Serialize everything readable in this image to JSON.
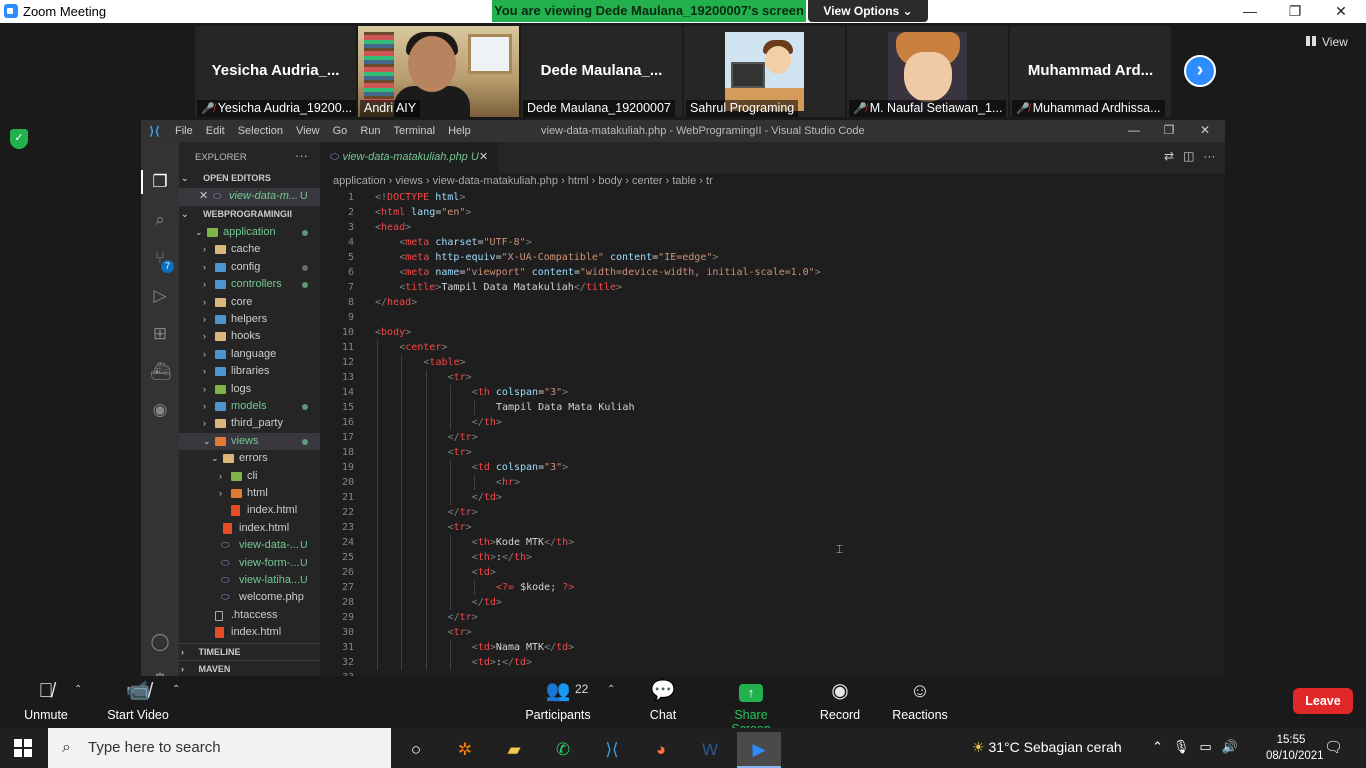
{
  "zoom": {
    "window_title": "Zoom Meeting",
    "share_banner": "You are viewing Dede Maulana_19200007's screen",
    "view_options": "View Options ⌄",
    "view_label": "View",
    "participants": [
      {
        "big_name": "Yesicha  Audria_...",
        "caption": "Yesicha Audria_19200...",
        "muted": true
      },
      {
        "big_name": "",
        "caption": "Andri AIY",
        "muted": false
      },
      {
        "big_name": "Dede  Maulana_...",
        "caption": "Dede Maulana_19200007",
        "muted": false
      },
      {
        "big_name": "",
        "caption": "Sahrul Programing",
        "muted": false
      },
      {
        "big_name": "",
        "caption": "M. Naufal Setiawan_1...",
        "muted": true
      },
      {
        "big_name": "Muhammad  Ard...",
        "caption": "Muhammad Ardhissa...",
        "muted": true
      }
    ],
    "toolbar": {
      "unmute": "Unmute",
      "start_video": "Start Video",
      "participants": "Participants",
      "participants_count": "22",
      "chat": "Chat",
      "share_screen": "Share Screen",
      "record": "Record",
      "reactions": "Reactions",
      "leave": "Leave"
    }
  },
  "vscode": {
    "menu": [
      "File",
      "Edit",
      "Selection",
      "View",
      "Go",
      "Run",
      "Terminal",
      "Help"
    ],
    "window_title": "view-data-matakuliah.php - WebProgramingII - Visual Studio Code",
    "explorer_title": "EXPLORER",
    "open_editors_label": "OPEN EDITORS",
    "open_editor_file": "view-data-m...",
    "open_editor_status": "U",
    "workspace_label": "WEBPROGRAMINGII",
    "timeline_label": "TIMELINE",
    "maven_label": "MAVEN",
    "scm_badge": "7",
    "tree": [
      {
        "label": "application",
        "depth": 1,
        "open": true,
        "kind": "folder-green",
        "status": "dot"
      },
      {
        "label": "cache",
        "depth": 2,
        "open": false,
        "kind": "folder"
      },
      {
        "label": "config",
        "depth": 2,
        "open": false,
        "kind": "folder-blue",
        "status": "dot-grey"
      },
      {
        "label": "controllers",
        "depth": 2,
        "open": false,
        "kind": "folder-blue",
        "status": "dot"
      },
      {
        "label": "core",
        "depth": 2,
        "open": false,
        "kind": "folder"
      },
      {
        "label": "helpers",
        "depth": 2,
        "open": false,
        "kind": "folder-blue"
      },
      {
        "label": "hooks",
        "depth": 2,
        "open": false,
        "kind": "folder"
      },
      {
        "label": "language",
        "depth": 2,
        "open": false,
        "kind": "folder-blue"
      },
      {
        "label": "libraries",
        "depth": 2,
        "open": false,
        "kind": "folder-blue"
      },
      {
        "label": "logs",
        "depth": 2,
        "open": false,
        "kind": "folder-green"
      },
      {
        "label": "models",
        "depth": 2,
        "open": false,
        "kind": "folder-blue",
        "status": "dot"
      },
      {
        "label": "third_party",
        "depth": 2,
        "open": false,
        "kind": "folder"
      },
      {
        "label": "views",
        "depth": 2,
        "open": true,
        "kind": "folder-red",
        "status": "dot",
        "selected": true
      },
      {
        "label": "errors",
        "depth": 3,
        "open": true,
        "kind": "folder"
      },
      {
        "label": "cli",
        "depth": 4,
        "open": false,
        "kind": "folder-green"
      },
      {
        "label": "html",
        "depth": 4,
        "open": false,
        "kind": "folder-red"
      },
      {
        "label": "index.html",
        "depth": 4,
        "kind": "html"
      },
      {
        "label": "index.html",
        "depth": 3,
        "kind": "html"
      },
      {
        "label": "view-data-...",
        "depth": 3,
        "kind": "php",
        "status": "U"
      },
      {
        "label": "view-form-...",
        "depth": 3,
        "kind": "php",
        "status": "U"
      },
      {
        "label": "view-latiha...",
        "depth": 3,
        "kind": "php",
        "status": "U"
      },
      {
        "label": "welcome.php",
        "depth": 3,
        "kind": "php"
      },
      {
        "label": ".htaccess",
        "depth": 2,
        "kind": "file"
      },
      {
        "label": "index.html",
        "depth": 2,
        "kind": "html"
      }
    ],
    "tab_label": "view-data-matakuliah.php",
    "tab_status": "U",
    "breadcrumb": [
      "application",
      "views",
      "view-data-matakuliah.php",
      "html",
      "body",
      "center",
      "table",
      "tr"
    ],
    "code_lines": [
      {
        "n": "1",
        "indent": 0,
        "html": "<span class='br'>&lt;!</span><span class='tagr'>DOCTYPE</span> <span class='attr'>html</span><span class='br'>&gt;</span>"
      },
      {
        "n": "2",
        "indent": 0,
        "html": "<span class='br'>&lt;</span><span class='tagr'>html</span> <span class='attr'>lang</span>=<span class='str'>\"en\"</span><span class='br'>&gt;</span>"
      },
      {
        "n": "3",
        "indent": 0,
        "html": "<span class='br'>&lt;</span><span class='tagr'>head</span><span class='br'>&gt;</span>"
      },
      {
        "n": "4",
        "indent": 1,
        "html": "<span class='br'>&lt;</span><span class='tagr'>meta</span> <span class='attr'>charset</span>=<span class='str'>\"UTF-8\"</span><span class='br'>&gt;</span>"
      },
      {
        "n": "5",
        "indent": 1,
        "html": "<span class='br'>&lt;</span><span class='tagr'>meta</span> <span class='attr'>http-equiv</span>=<span class='str'>\"X-UA-Compatible\"</span> <span class='attr'>content</span>=<span class='str'>\"IE=edge\"</span><span class='br'>&gt;</span>"
      },
      {
        "n": "6",
        "indent": 1,
        "html": "<span class='br'>&lt;</span><span class='tagr'>meta</span> <span class='attr'>name</span>=<span class='str'>\"viewport\"</span> <span class='attr'>content</span>=<span class='str'>\"width=device-width, initial-scale=1.0\"</span><span class='br'>&gt;</span>"
      },
      {
        "n": "7",
        "indent": 1,
        "html": "<span class='br'>&lt;</span><span class='tagr'>title</span><span class='br'>&gt;</span>Tampil Data Matakuliah<span class='br'>&lt;/</span><span class='tagr'>title</span><span class='br'>&gt;</span>"
      },
      {
        "n": "8",
        "indent": 0,
        "html": "<span class='br'>&lt;/</span><span class='tagr'>head</span><span class='br'>&gt;</span>"
      },
      {
        "n": "9",
        "indent": 0,
        "html": ""
      },
      {
        "n": "10",
        "indent": 0,
        "html": "<span class='br'>&lt;</span><span class='tagr'>body</span><span class='br'>&gt;</span>"
      },
      {
        "n": "11",
        "indent": 1,
        "html": "<span class='br'>&lt;</span><span class='tagr'>center</span><span class='br'>&gt;</span>"
      },
      {
        "n": "12",
        "indent": 2,
        "html": "<span class='br'>&lt;</span><span class='tagr'>table</span><span class='br'>&gt;</span>"
      },
      {
        "n": "13",
        "indent": 3,
        "html": "<span class='br'>&lt;</span><span class='tagr'>tr</span><span class='br'>&gt;</span>"
      },
      {
        "n": "14",
        "indent": 4,
        "html": "<span class='br'>&lt;</span><span class='tagr'>th</span> <span class='attr'>colspan</span>=<span class='str'>\"3\"</span><span class='br'>&gt;</span>"
      },
      {
        "n": "15",
        "indent": 5,
        "html": "Tampil Data Mata Kuliah"
      },
      {
        "n": "16",
        "indent": 4,
        "html": "<span class='br'>&lt;/</span><span class='tagr'>th</span><span class='br'>&gt;</span>"
      },
      {
        "n": "17",
        "indent": 3,
        "html": "<span class='br'>&lt;/</span><span class='tagr'>tr</span><span class='br'>&gt;</span>"
      },
      {
        "n": "18",
        "indent": 3,
        "html": "<span class='br'>&lt;</span><span class='tagr'>tr</span><span class='br'>&gt;</span>"
      },
      {
        "n": "19",
        "indent": 4,
        "html": "<span class='br'>&lt;</span><span class='tagr'>td</span> <span class='attr'>colspan</span>=<span class='str'>\"3\"</span><span class='br'>&gt;</span>"
      },
      {
        "n": "20",
        "indent": 5,
        "html": "<span class='br'>&lt;</span><span class='tagr'>hr</span><span class='br'>&gt;</span>"
      },
      {
        "n": "21",
        "indent": 4,
        "html": "<span class='br'>&lt;/</span><span class='tagr'>td</span><span class='br'>&gt;</span>"
      },
      {
        "n": "22",
        "indent": 3,
        "html": "<span class='br'>&lt;/</span><span class='tagr'>tr</span><span class='br'>&gt;</span>"
      },
      {
        "n": "23",
        "indent": 3,
        "html": "<span class='br'>&lt;</span><span class='tagr'>tr</span><span class='br'>&gt;</span>"
      },
      {
        "n": "24",
        "indent": 4,
        "html": "<span class='br'>&lt;</span><span class='tagr'>th</span><span class='br'>&gt;</span>Kode MTK<span class='br'>&lt;/</span><span class='tagr'>th</span><span class='br'>&gt;</span>"
      },
      {
        "n": "25",
        "indent": 4,
        "html": "<span class='br'>&lt;</span><span class='tagr'>th</span><span class='br'>&gt;</span>:<span class='br'>&lt;/</span><span class='tagr'>th</span><span class='br'>&gt;</span>"
      },
      {
        "n": "26",
        "indent": 4,
        "html": "<span class='br'>&lt;</span><span class='tagr'>td</span><span class='br'>&gt;</span>"
      },
      {
        "n": "27",
        "indent": 5,
        "html": "<span class='php'>&lt;?=</span> <span class='var'>$kode</span>; <span class='php'>?&gt;</span>"
      },
      {
        "n": "28",
        "indent": 4,
        "html": "<span class='br'>&lt;/</span><span class='tagr'>td</span><span class='br'>&gt;</span>"
      },
      {
        "n": "29",
        "indent": 3,
        "html": "<span class='br'>&lt;/</span><span class='tagr'>tr</span><span class='br'>&gt;</span>"
      },
      {
        "n": "30",
        "indent": 3,
        "html": "<span class='br'>&lt;</span><span class='tagr'>tr</span><span class='br'>&gt;</span>"
      },
      {
        "n": "31",
        "indent": 4,
        "html": "<span class='br'>&lt;</span><span class='tagr'>td</span><span class='br'>&gt;</span>Nama MTK<span class='br'>&lt;/</span><span class='tagr'>td</span><span class='br'>&gt;</span>"
      },
      {
        "n": "32",
        "indent": 4,
        "html": "<span class='br'>&lt;</span><span class='tagr'>td</span><span class='br'>&gt;</span>:<span class='br'>&lt;/</span><span class='tagr'>td</span><span class='br'>&gt;</span>"
      },
      {
        "n": "33",
        "indent": 4,
        "html": ""
      }
    ]
  },
  "taskbar": {
    "search_placeholder": "Type here to search",
    "weather": "31°C  Sebagian cerah",
    "time": "15:55",
    "date": "08/10/2021"
  }
}
